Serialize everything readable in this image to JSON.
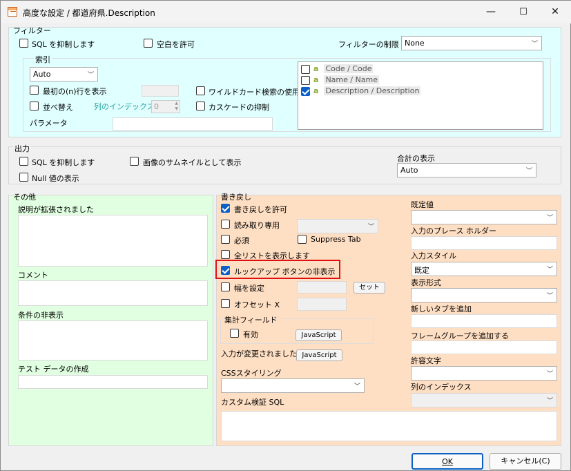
{
  "window": {
    "title": "高度な設定 / 都道府県.Description",
    "minimize": "—",
    "maximize": "☐",
    "close": "✕"
  },
  "filter": {
    "group_title": "フィルター",
    "sql_suppress": "SQL を抑制します",
    "allow_blank": "空白を許可",
    "limit_label": "フィルターの制限",
    "limit_value": "None",
    "index_group": "索引",
    "index_value": "Auto",
    "show_first_n": "最初の(n)行を表示",
    "sort": "並べ替え",
    "column_index": "列のインデックス",
    "column_index_value": "0",
    "wildcard": "ワイルドカード検索の使用",
    "cascade": "カスケードの抑制",
    "params": "パラメータ",
    "list": [
      {
        "icon": "a",
        "text": "Code / Code",
        "checked": false
      },
      {
        "icon": "a",
        "text": "Name / Name",
        "checked": false
      },
      {
        "icon": "a",
        "text": "Description / Description",
        "checked": true
      }
    ]
  },
  "output": {
    "group_title": "出力",
    "sql_suppress": "SQL を抑制します",
    "thumbnail": "画像のサムネイルとして表示",
    "null_show": "Null 値の表示",
    "total_label": "合計の表示",
    "total_value": "Auto"
  },
  "other": {
    "group_title": "その他",
    "desc_expanded": "説明が拡張されました",
    "comment": "コメント",
    "hide_condition": "条件の非表示",
    "test_data": "テスト データの作成"
  },
  "writeback": {
    "group_title": "書き戻し",
    "allow": "書き戻しを許可",
    "readonly": "読み取り専用",
    "required": "必須",
    "suppress_tab": "Suppress Tab",
    "show_all": "全リストを表示します",
    "hide_lookup": "ルックアップ ボタンの非表示",
    "set_width": "幅を設定",
    "set_button": "セット",
    "offset_x": "オフセット X",
    "agg_group": "集計フィールド",
    "enabled": "有効",
    "js1": "JavaScript",
    "on_change": "入力が変更されました",
    "js2": "JavaScript",
    "css": "CSSスタイリング",
    "custom_sql": "カスタム検証 SQL",
    "default_value": "既定値",
    "placeholder": "入力のプレース ホルダー",
    "input_style": "入力スタイル",
    "input_style_value": "既定",
    "display_format": "表示形式",
    "new_tab": "新しいタブを追加",
    "frame_group": "フレームグループを追加する",
    "allowed_chars": "許容文字",
    "col_index": "列のインデックス"
  },
  "footer": {
    "ok": "OK",
    "cancel": "キャンセル(C)"
  },
  "colors": {
    "filter_bg": "#e0ffff",
    "other_bg": "#e1ffe1",
    "writeback_bg": "#ffdfc3",
    "highlight": "#e01010",
    "check": "#0b5fc6"
  }
}
